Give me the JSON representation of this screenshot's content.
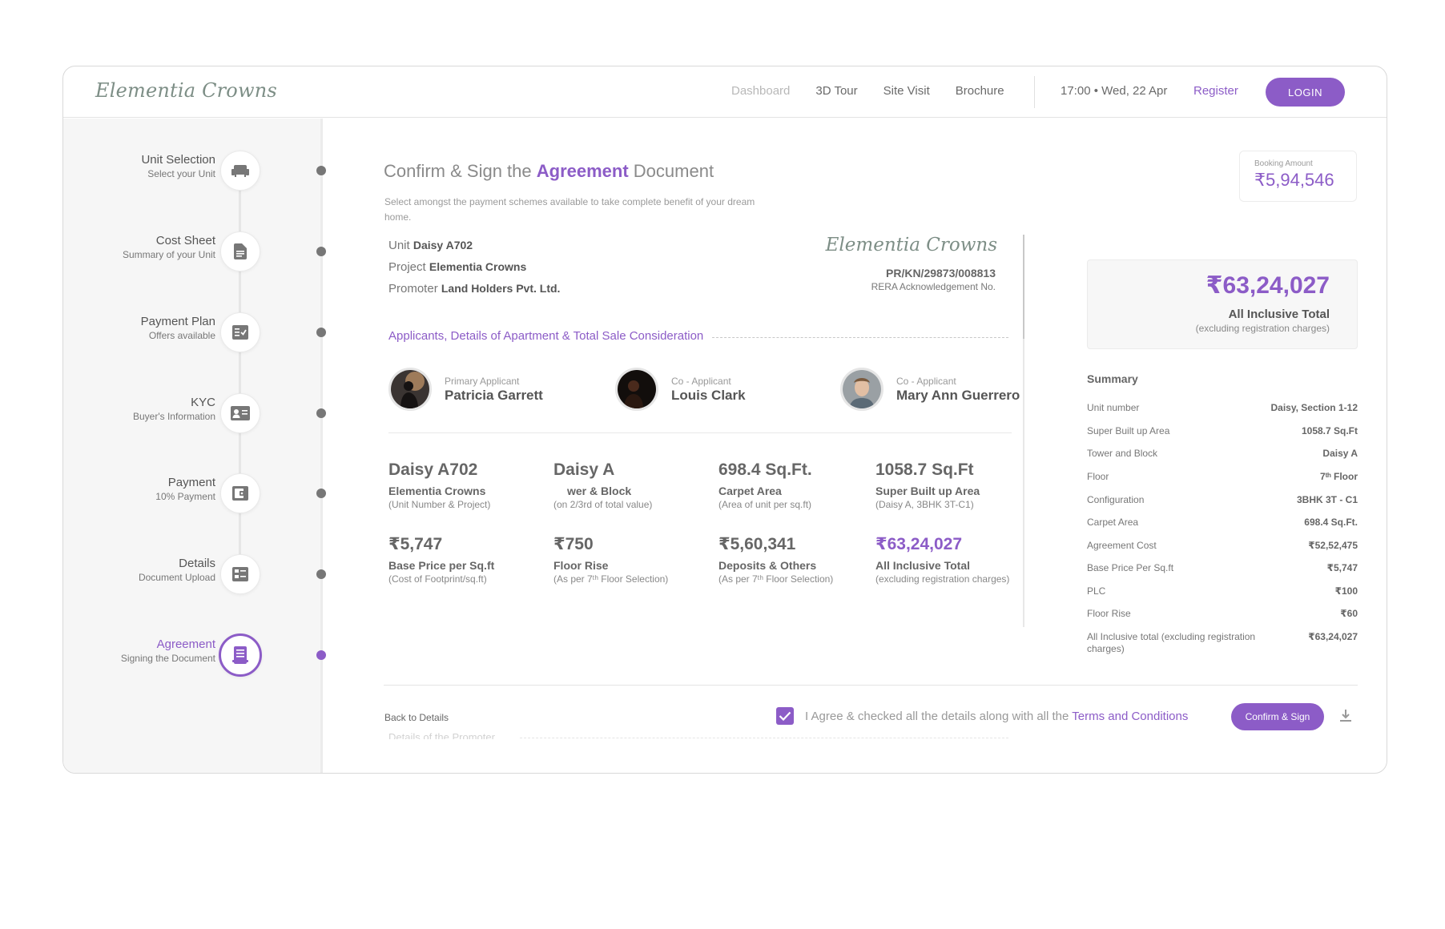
{
  "header": {
    "logo": "Elementia Crowns",
    "nav": [
      "Dashboard",
      "3D Tour",
      "Site Visit",
      "Brochure"
    ],
    "clock": "17:00 • Wed, 22 Apr",
    "register": "Register",
    "login": "LOGIN"
  },
  "steps": [
    {
      "title": "Unit Selection",
      "sub": "Select your Unit",
      "icon": "sofa-icon"
    },
    {
      "title": "Cost Sheet",
      "sub": "Summary of your Unit",
      "icon": "document-icon"
    },
    {
      "title": "Payment Plan",
      "sub": "Offers available",
      "icon": "checklist-icon"
    },
    {
      "title": "KYC",
      "sub": "Buyer's Information",
      "icon": "id-card-icon"
    },
    {
      "title": "Payment",
      "sub": "10% Payment",
      "icon": "wallet-icon"
    },
    {
      "title": "Details",
      "sub": "Document Upload",
      "icon": "form-icon"
    },
    {
      "title": "Agreement",
      "sub": "Signing the Document",
      "icon": "agreement-icon"
    }
  ],
  "main": {
    "title_pre": "Confirm & Sign the ",
    "title_bold": "Agreement",
    "title_post": " Document",
    "subtitle": "Select amongst the payment schemes available to take complete benefit of your dream home.",
    "booking_label": "Booking Amount",
    "booking_value": "₹5,94,546"
  },
  "doc": {
    "unit_label": "Unit",
    "unit_value": "Daisy A702",
    "project_label": "Project",
    "project_value": "Elementia Crowns",
    "promoter_label": "Promoter",
    "promoter_value": "Land Holders Pvt. Ltd.",
    "logo": "Elementia Crowns",
    "rera_no": "PR/KN/29873/008813",
    "rera_label": "RERA Acknowledgement No.",
    "section_title": "Applicants, Details of Apartment & Total Sale Consideration",
    "applicants": [
      {
        "role": "Primary Applicant",
        "name": "Patricia Garrett"
      },
      {
        "role": "Co - Applicant",
        "name": "Louis Clark"
      },
      {
        "role": "Co - Applicant",
        "name": "Mary Ann Guerrero"
      }
    ],
    "stats": [
      {
        "value": "Daisy A702",
        "label": "Elementia Crowns",
        "sub": "(Unit Number & Project)"
      },
      {
        "value": "Daisy A",
        "label": "wer & Block",
        "sub": "(on 2/3rd of total value)"
      },
      {
        "value": "698.4 Sq.Ft.",
        "label": "Carpet Area",
        "sub": "(Area of unit per sq.ft)"
      },
      {
        "value": "1058.7 Sq.Ft",
        "label": "Super Built up Area",
        "sub": "(Daisy A, 3BHK 3T-C1)"
      },
      {
        "value": "₹5,747",
        "label": "Base Price per Sq.ft",
        "sub": "(Cost of Footprint/sq.ft)"
      },
      {
        "value": "₹750",
        "label": "Floor Rise",
        "sub": "(As per 7ᵗʰ Floor Selection)"
      },
      {
        "value": "₹5,60,341",
        "label": "Deposits & Others",
        "sub": "(As per 7ᵗʰ Floor Selection)"
      },
      {
        "value": "₹63,24,027",
        "label": "All Inclusive Total",
        "sub": "(excluding registration charges)"
      }
    ],
    "next_section": "Details of the Promoter"
  },
  "summary": {
    "total_value": "₹63,24,027",
    "total_label": "All Inclusive Total",
    "total_sub": "(excluding registration charges)",
    "heading": "Summary",
    "rows": [
      {
        "k": "Unit number",
        "v": "Daisy, Section 1-12"
      },
      {
        "k": "Super Built up Area",
        "v": "1058.7 Sq.Ft"
      },
      {
        "k": "Tower and Block",
        "v": "Daisy A"
      },
      {
        "k": "Floor",
        "v": "7ᵗʰ Floor"
      },
      {
        "k": "Configuration",
        "v": "3BHK 3T - C1"
      },
      {
        "k": "Carpet Area",
        "v": "698.4 Sq.Ft."
      },
      {
        "k": "Agreement Cost",
        "v": "₹52,52,475"
      },
      {
        "k": "Base Price Per Sq.ft",
        "v": "₹5,747"
      },
      {
        "k": "PLC",
        "v": "₹100"
      },
      {
        "k": "Floor Rise",
        "v": "₹60"
      },
      {
        "k": "All Inclusive total (excluding registration charges)",
        "v": "₹63,24,027"
      }
    ]
  },
  "footer": {
    "back": "Back to Details",
    "agree_text": "I Agree & checked all the details along with all the ",
    "terms": "Terms and Conditions",
    "confirm": "Confirm & Sign"
  },
  "colors": {
    "accent": "#8c5cc7",
    "logo": "#7d8e86"
  }
}
